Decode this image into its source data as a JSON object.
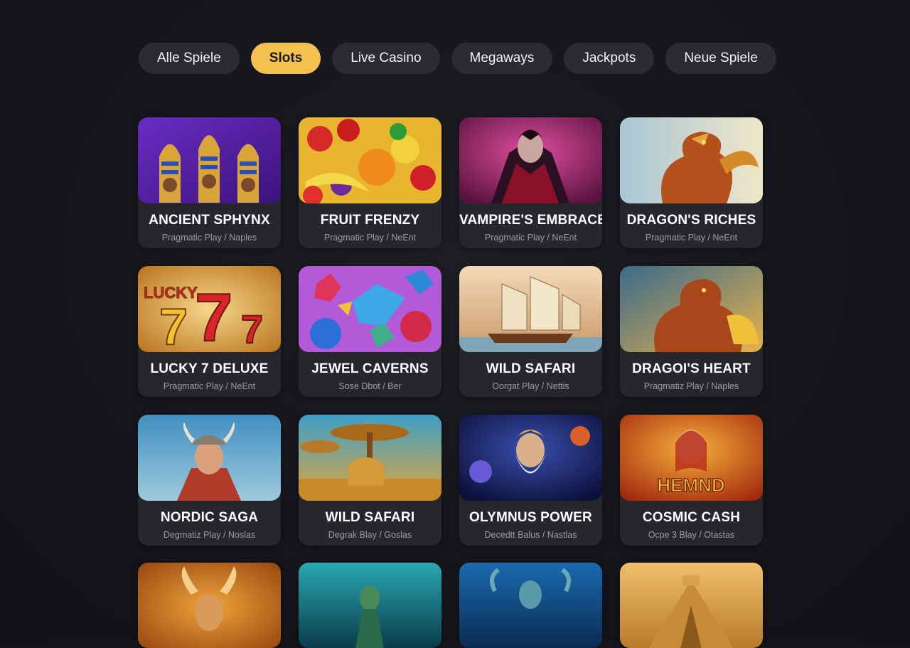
{
  "tabs": [
    {
      "label": "Alle Spiele",
      "active": false
    },
    {
      "label": "Slots",
      "active": true
    },
    {
      "label": "Live Casino",
      "active": false
    },
    {
      "label": "Megaways",
      "active": false
    },
    {
      "label": "Jackpots",
      "active": false
    },
    {
      "label": "Neue Spiele",
      "active": false
    }
  ],
  "games": [
    {
      "title": "ANCIENT SPHYNX",
      "provider": "Pragmatic Play / Naples",
      "thumb": "pharaoh"
    },
    {
      "title": "FRUIT FRENZY",
      "provider": "Pragmatic Play / NeEnt",
      "thumb": "fruit"
    },
    {
      "title": "VAMPIRE'S EMBRACE",
      "provider": "Pragmatic Play / NeEnt",
      "thumb": "vampire"
    },
    {
      "title": "DRAGON'S RICHES",
      "provider": "Pragmatic Play / NeEnt",
      "thumb": "dragon"
    },
    {
      "title": "LUCKY 7 DELUXE",
      "provider": "Pragmatic Play / NeEnt",
      "thumb": "lucky7"
    },
    {
      "title": "JEWEL CAVERNS",
      "provider": "Sose Dbot / Ber",
      "thumb": "jewels"
    },
    {
      "title": "WILD SAFARI",
      "provider": "Oorgat Play / Nettis",
      "thumb": "ship"
    },
    {
      "title": "DRAGOI'S HEART",
      "provider": "Pragmatiz Play / Naples",
      "thumb": "dragon2"
    },
    {
      "title": "NORDIC SAGA",
      "provider": "Degmatiz Play / Noslas",
      "thumb": "viking"
    },
    {
      "title": "WILD SAFARI",
      "provider": "Degrak Blay / Goslas",
      "thumb": "safari"
    },
    {
      "title": "OLYMNUS POWER",
      "provider": "Decedtt Balus / Nastlas",
      "thumb": "zeus"
    },
    {
      "title": "COSMIC CASH",
      "provider": "Ocpe 3 Blay / Otastas",
      "thumb": "hemnd",
      "logo": "HEMND"
    },
    {
      "title": "",
      "provider": "",
      "thumb": "horned"
    },
    {
      "title": "",
      "provider": "",
      "thumb": "underwater"
    },
    {
      "title": "",
      "provider": "",
      "thumb": "ocean"
    },
    {
      "title": "",
      "provider": "",
      "thumb": "pyramid"
    }
  ],
  "colors": {
    "accent": "#f4c04f",
    "card": "#25272d",
    "tab": "#2a2c32"
  }
}
